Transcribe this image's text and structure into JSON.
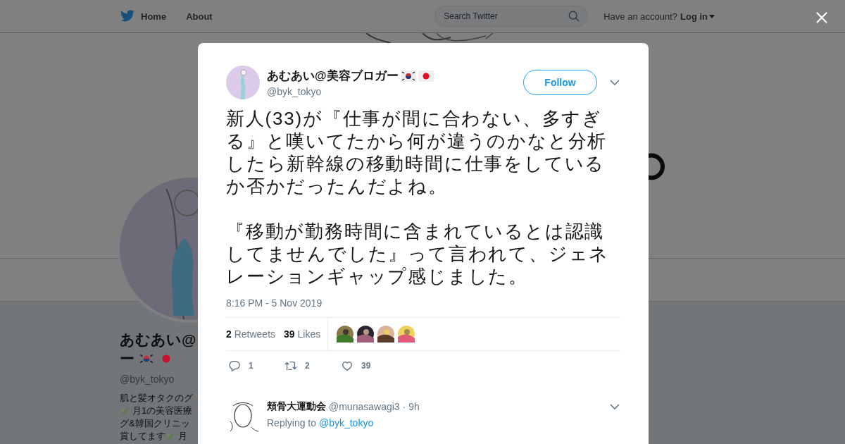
{
  "nav": {
    "items": [
      {
        "label": "Home"
      },
      {
        "label": "About"
      }
    ],
    "search": {
      "placeholder": "Search Twitter"
    },
    "account_prompt": "Have an account?",
    "login": "Log in"
  },
  "profile": {
    "name_lines": [
      "あむあい@",
      "ー"
    ],
    "handle": "@byk_tokyo",
    "bio_lines": [
      [
        {
          "kind": "text",
          "text": "肌と髪オタクのグ"
        }
      ],
      [
        {
          "kind": "leaf"
        },
        {
          "kind": "text",
          "text": "月1の美容医療"
        }
      ],
      [
        {
          "kind": "text",
          "text": "グ&韓国クリニッ"
        }
      ],
      [
        {
          "kind": "text",
          "text": "賞してます"
        },
        {
          "kind": "leaf"
        },
        {
          "kind": "text",
          "text": "月"
        }
      ]
    ]
  },
  "tweet": {
    "name": "あむあい@美容ブロガー",
    "handle": "@byk_tokyo",
    "follow": "Follow",
    "paragraphs": [
      "新人(33)が『仕事が間に合わない、多すぎる』と嘆いてたから何が違うのかなと分析したら新幹線の移動時間に仕事をしているか否かだったんだよね。",
      "『移動が勤務時間に含まれているとは認識してませんでした』って言われて、ジェネレーションギャップ感じました。"
    ],
    "time": "8:16 PM - 5 Nov 2019",
    "stats": [
      {
        "count": "2",
        "label": "Retweets"
      },
      {
        "count": "39",
        "label": "Likes"
      }
    ],
    "likers": [
      {
        "kind": "picture"
      },
      {
        "kind": "picture"
      },
      {
        "kind": "picture"
      },
      {
        "kind": "picture"
      }
    ],
    "actions": [
      {
        "kind": "reply",
        "count": "1"
      },
      {
        "kind": "retweet",
        "count": "2"
      },
      {
        "kind": "like",
        "count": "39"
      }
    ]
  },
  "reply": {
    "name": "頬骨大運動会",
    "handle": "@munasawagi3",
    "separator": "·",
    "age": "9h",
    "replying_to": "Replying to",
    "mention": "@byk_tokyo"
  }
}
